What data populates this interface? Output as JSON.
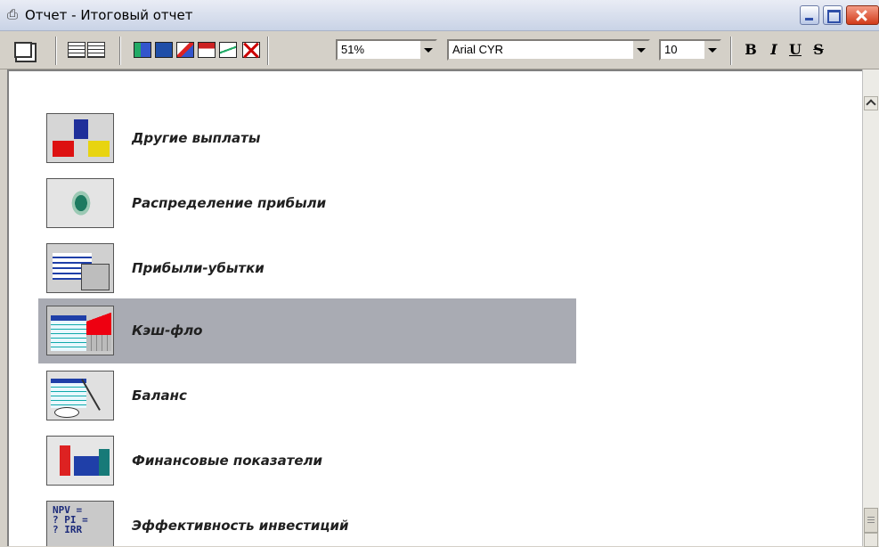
{
  "window": {
    "title": "Отчет - Итоговый отчет",
    "title_icon": "printer-icon"
  },
  "toolbar": {
    "zoom_value": "51%",
    "font_value": "Arial CYR",
    "size_value": "10",
    "bold_label": "B",
    "italic_label": "I",
    "underline_label": "U",
    "strike_label": "S"
  },
  "report": {
    "items": [
      {
        "label": "Другие выплаты",
        "icon": "other-payments-icon",
        "selected": false
      },
      {
        "label": "Распределение прибыли",
        "icon": "profit-distribution-icon",
        "selected": false
      },
      {
        "label": "Прибыли-убытки",
        "icon": "profit-loss-icon",
        "selected": false
      },
      {
        "label": "Кэш-фло",
        "icon": "cash-flow-icon",
        "selected": true
      },
      {
        "label": "Баланс",
        "icon": "balance-icon",
        "selected": false
      },
      {
        "label": "Финансовые показатели",
        "icon": "financial-indicators-icon",
        "selected": false
      },
      {
        "label": "Эффективность инвестиций",
        "icon": "investment-efficiency-icon",
        "selected": false
      }
    ],
    "investment_icon_text": "NPV = ? PI = ? IRR"
  }
}
